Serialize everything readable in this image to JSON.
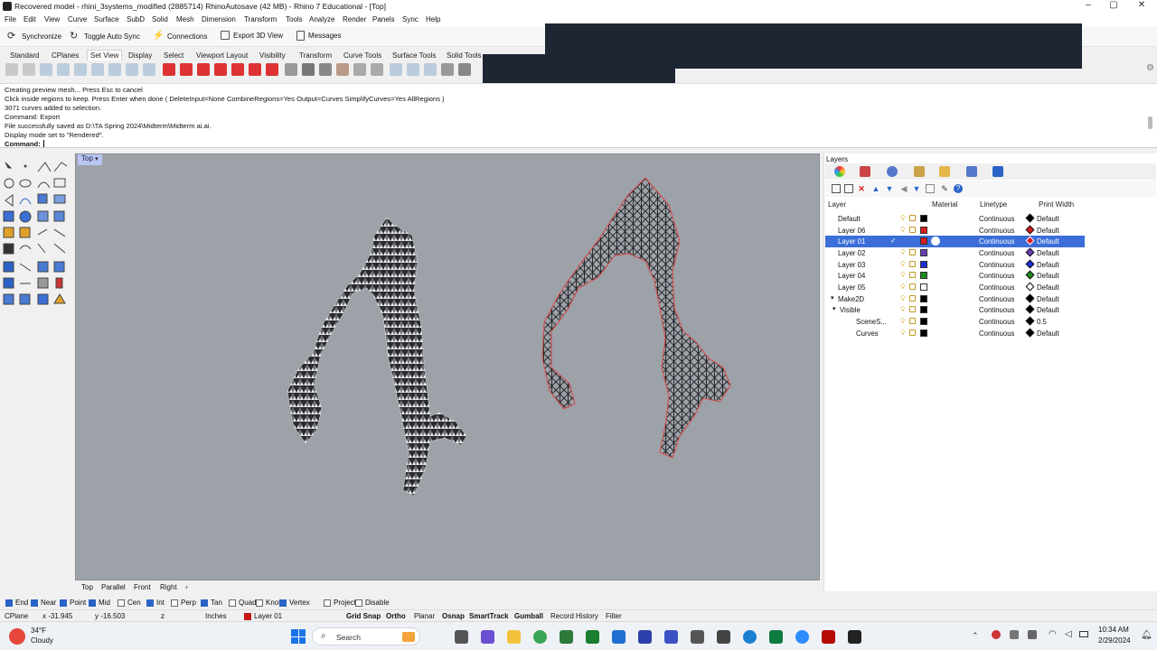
{
  "window": {
    "title": "Recovered model - rhini_3systems_modified (2885714) RhinoAutosave (42 MB) - Rhino 7 Educational - [Top]",
    "controls": [
      "–",
      "▢",
      "✕"
    ]
  },
  "menu": [
    "File",
    "Edit",
    "View",
    "Curve",
    "Surface",
    "SubD",
    "Solid",
    "Mesh",
    "Dimension",
    "Transform",
    "Tools",
    "Analyze",
    "Render",
    "Panels",
    "Sync",
    "Help"
  ],
  "toolbar": {
    "synchronize": "Synchronize",
    "toggle_auto_sync": "Toggle Auto Sync",
    "connections": "Connections",
    "export_3d_view": "Export 3D View",
    "messages": "Messages"
  },
  "toolbar_tabs": [
    "Standard",
    "CPlanes",
    "Set View",
    "Display",
    "Select",
    "Viewport Layout",
    "Visibility",
    "Transform",
    "Curve Tools",
    "Surface Tools",
    "Solid Tools"
  ],
  "command_history": [
    "Creating preview mesh... Press Esc to cancel",
    "Click inside regions to keep. Press Enter when done ( DeleteInput=None  CombineRegions=Yes  Output=Curves  SimplifyCurves=Yes  AllRegions )",
    "3071 curves added to selection.",
    "Command: Export",
    "File successfully saved as D:\\TA Spring 2024\\Midterm\\Midterm ai.ai.",
    "Display mode set to \"Rendered\"."
  ],
  "command_prompt": "Command:",
  "viewport": {
    "name": "Top",
    "tabs": [
      "Top",
      "Parallel",
      "Front",
      "Right",
      "+"
    ]
  },
  "layers_panel": {
    "title": "Layers",
    "columns": [
      "Layer",
      "Material",
      "Linetype",
      "Print Width"
    ],
    "rows": [
      {
        "name": "Default",
        "color": "#000000",
        "linetype": "Continuous",
        "print_width": "Default",
        "selected": false
      },
      {
        "name": "Layer 06",
        "color": "#d81e1e",
        "linetype": "Continuous",
        "print_width": "Default",
        "selected": false
      },
      {
        "name": "Layer 01",
        "color": "#d81e1e",
        "linetype": "Continuous",
        "print_width": "Default",
        "selected": true
      },
      {
        "name": "Layer 02",
        "color": "#6b3fb5",
        "linetype": "Continuous",
        "print_width": "Default",
        "selected": false
      },
      {
        "name": "Layer 03",
        "color": "#1e2fd8",
        "linetype": "Continuous",
        "print_width": "Default",
        "selected": false
      },
      {
        "name": "Layer 04",
        "color": "#1e8a1e",
        "linetype": "Continuous",
        "print_width": "Default",
        "selected": false
      },
      {
        "name": "Layer 05",
        "color": "#ffffff",
        "linetype": "Continuous",
        "print_width": "Default",
        "selected": false
      },
      {
        "name": "Make2D",
        "color": "#000000",
        "linetype": "Continuous",
        "print_width": "Default",
        "selected": false
      },
      {
        "name": "Visible",
        "color": "#000000",
        "linetype": "Continuous",
        "print_width": "Default",
        "selected": false
      },
      {
        "name": "SceneS...",
        "color": "#000000",
        "linetype": "Continuous",
        "print_width": "0.5",
        "selected": false
      },
      {
        "name": "Curves",
        "color": "#000000",
        "linetype": "Continuous",
        "print_width": "Default",
        "selected": false
      }
    ]
  },
  "osnaps": [
    {
      "label": "End",
      "on": true
    },
    {
      "label": "Near",
      "on": true
    },
    {
      "label": "Point",
      "on": true
    },
    {
      "label": "Mid",
      "on": true
    },
    {
      "label": "Cen",
      "on": false
    },
    {
      "label": "Int",
      "on": true
    },
    {
      "label": "Perp",
      "on": false
    },
    {
      "label": "Tan",
      "on": true
    },
    {
      "label": "Quad",
      "on": false
    },
    {
      "label": "Knot",
      "on": false
    },
    {
      "label": "Vertex",
      "on": true
    },
    {
      "label": "Project",
      "on": false
    },
    {
      "label": "Disable",
      "on": false
    }
  ],
  "status": {
    "cplane": "CPlane",
    "x": "x -31.945",
    "y": "y -16.503",
    "z": "z",
    "units": "Inches",
    "layer": "Layer 01",
    "grid_snap": "Grid Snap",
    "ortho": "Ortho",
    "planar": "Planar",
    "osnap": "Osnap",
    "smarttrack": "SmartTrack",
    "gumball": "Gumball",
    "record_history": "Record History",
    "filter": "Filter"
  },
  "taskbar": {
    "weather_temp": "34°F",
    "weather_desc": "Cloudy",
    "search": "Search",
    "time": "10:34 AM",
    "date": "2/29/2024"
  }
}
